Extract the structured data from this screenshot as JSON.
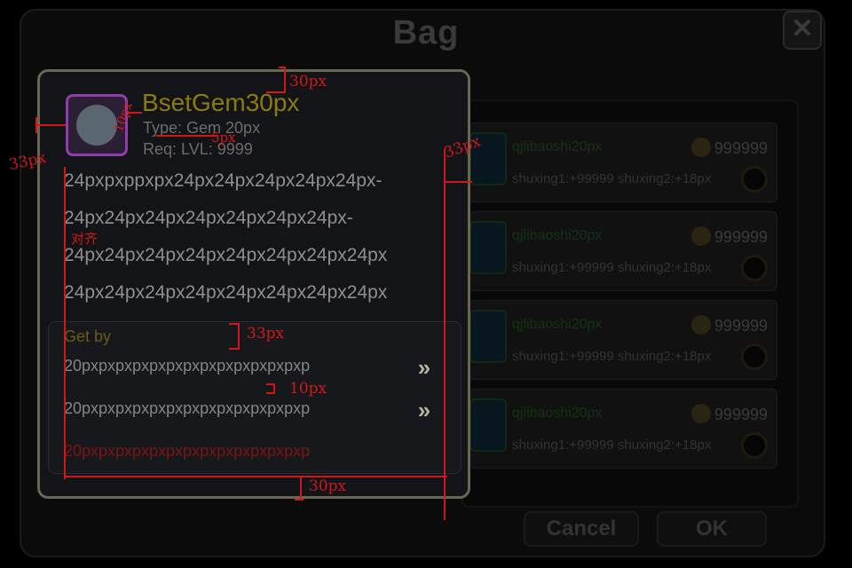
{
  "bag": {
    "title": "Bag",
    "close_symbol": "✕",
    "items": [
      {
        "name": "qjlibaoshi20px",
        "price": "999999",
        "attrs": "shuxing1:+99999 shuxing2:+18px"
      },
      {
        "name": "qjlibaoshi20px",
        "price": "999999",
        "attrs": "shuxing1:+99999 shuxing2:+18px"
      },
      {
        "name": "qjlibaoshi20px",
        "price": "999999",
        "attrs": "shuxing1:+99999 shuxing2:+18px"
      },
      {
        "name": "qjlibaoshi20px",
        "price": "999999",
        "attrs": "shuxing1:+99999 shuxing2:+18px"
      }
    ],
    "cancel_label": "Cancel",
    "ok_label": "OK"
  },
  "tooltip": {
    "name": "BsetGem30px",
    "type": "Type: Gem 20px",
    "req": "Req: LVL: 9999",
    "description": [
      "24pxpxppxpx24px24px24px24px24px-",
      "24px24px24px24px24px24px24px-",
      "24px24px24px24px24px24px24px24px",
      "24px24px24px24px24px24px24px24px"
    ],
    "get_by_title": "Get by",
    "sources": [
      {
        "text": "20pxpxpxpxpxpxpxpxpxpxpxpxpxp",
        "go": "»"
      },
      {
        "text": "20pxpxpxpxpxpxpxpxpxpxpxpxpxp",
        "go": "»"
      },
      {
        "text": "20pxpxpxpxpxpxpxpxpxpxpxpxpxp"
      }
    ],
    "colors": {
      "name": "#8c7a12",
      "border": "#6b6650",
      "gem_frame": "#8f3ea8",
      "disabled_source": "#7a1515"
    }
  },
  "annotations": {
    "top_gap": "30px",
    "left_gap": "33px",
    "icon_gap": "10px",
    "line_gap": "5px",
    "right_gap": "33px",
    "align_note": "对齐",
    "getby_gap": "33px",
    "row_gap": "10px",
    "bottom_gap": "30px",
    "color": "#d11818"
  }
}
